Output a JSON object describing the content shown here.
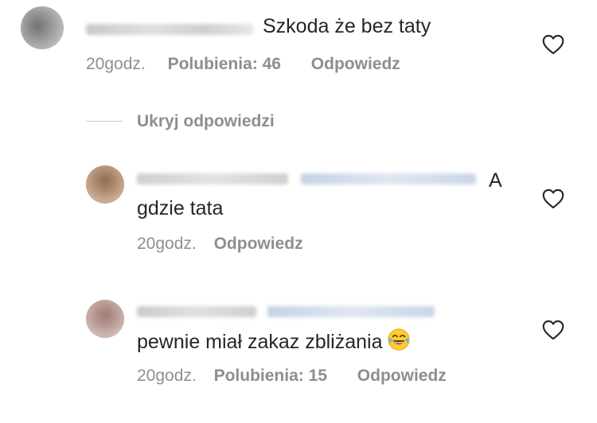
{
  "comments": [
    {
      "text": "Szkoda że bez taty",
      "time": "20godz.",
      "likes": "Polubienia: 46",
      "reply": "Odpowiedz"
    }
  ],
  "toggle_replies": "Ukryj odpowiedzi",
  "replies": [
    {
      "text_line1": "A",
      "text_line2": "gdzie tata",
      "time": "20godz.",
      "reply": "Odpowiedz"
    },
    {
      "text": "pewnie miał zakaz zbliżania",
      "emoji": "face-with-tears-of-joy-emoji",
      "time": "20godz.",
      "likes": "Polubienia: 15",
      "reply": "Odpowiedz"
    }
  ],
  "icons": {
    "like": "heart-outline-icon"
  },
  "colors": {
    "text": "#262626",
    "meta": "#8e8e8e",
    "divider": "#c7c7c7",
    "mention_blur": "#c9d6e6"
  }
}
